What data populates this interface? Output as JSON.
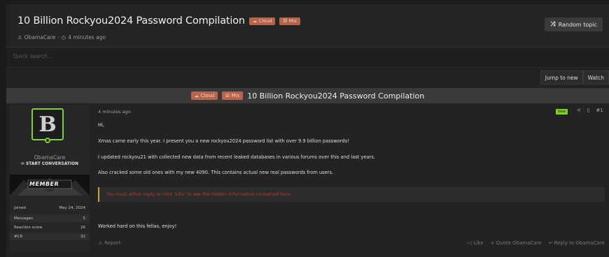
{
  "thread": {
    "title": "10 Billion Rockyou2024 Password Compilation",
    "tags": [
      {
        "icon": "cloud-icon",
        "glyph": "☁",
        "label": "Cloud"
      },
      {
        "icon": "mix-icon",
        "glyph": "⚄",
        "label": "Mix"
      }
    ],
    "author": "ObamaCare",
    "meta_sep": "·",
    "time": "4 minutes ago"
  },
  "header": {
    "random_topic": "Random topic"
  },
  "search": {
    "placeholder": "Quick search..."
  },
  "controls": {
    "jump_to_new": "Jump to new",
    "watch": "Watch"
  },
  "post": {
    "time": "4 minutes ago",
    "new_label": "New",
    "post_number": "#1",
    "lines": [
      "Hi,",
      "Xmas came early this year. I present you a new rockyou2024 password list with over 9.9 billion passwords!",
      "I updated rockyou21 with collected new data from recent leaked databases in various forums over this and last years.",
      "Also cracked some old ones with my new 4090. This contains actual new real passwords from users."
    ],
    "hidden_notice": "You must either reply or click 'Like' to see the hidden information contained here.",
    "closing": "Worked hard on this fellas, enjoy!"
  },
  "user": {
    "name": "ObamaCare",
    "start_conversation": "START CONVERSATION",
    "banner_label": "MEMBER",
    "stats": [
      {
        "label": "Joined",
        "value": "May 24, 2024"
      },
      {
        "label": "Messages",
        "value": "5"
      },
      {
        "label": "Reaction score",
        "value": "26"
      },
      {
        "label": "#CR",
        "value": "32"
      }
    ]
  },
  "footer": {
    "report": "Report",
    "like": "Like",
    "quote": "Quote ObamaCare",
    "reply": "Reply to ObamaCare"
  },
  "colors": {
    "accent_green": "#7ed321",
    "tag_bg": "#b8644a",
    "hidden_text": "#c0392b",
    "hidden_border": "#d5a02d"
  }
}
